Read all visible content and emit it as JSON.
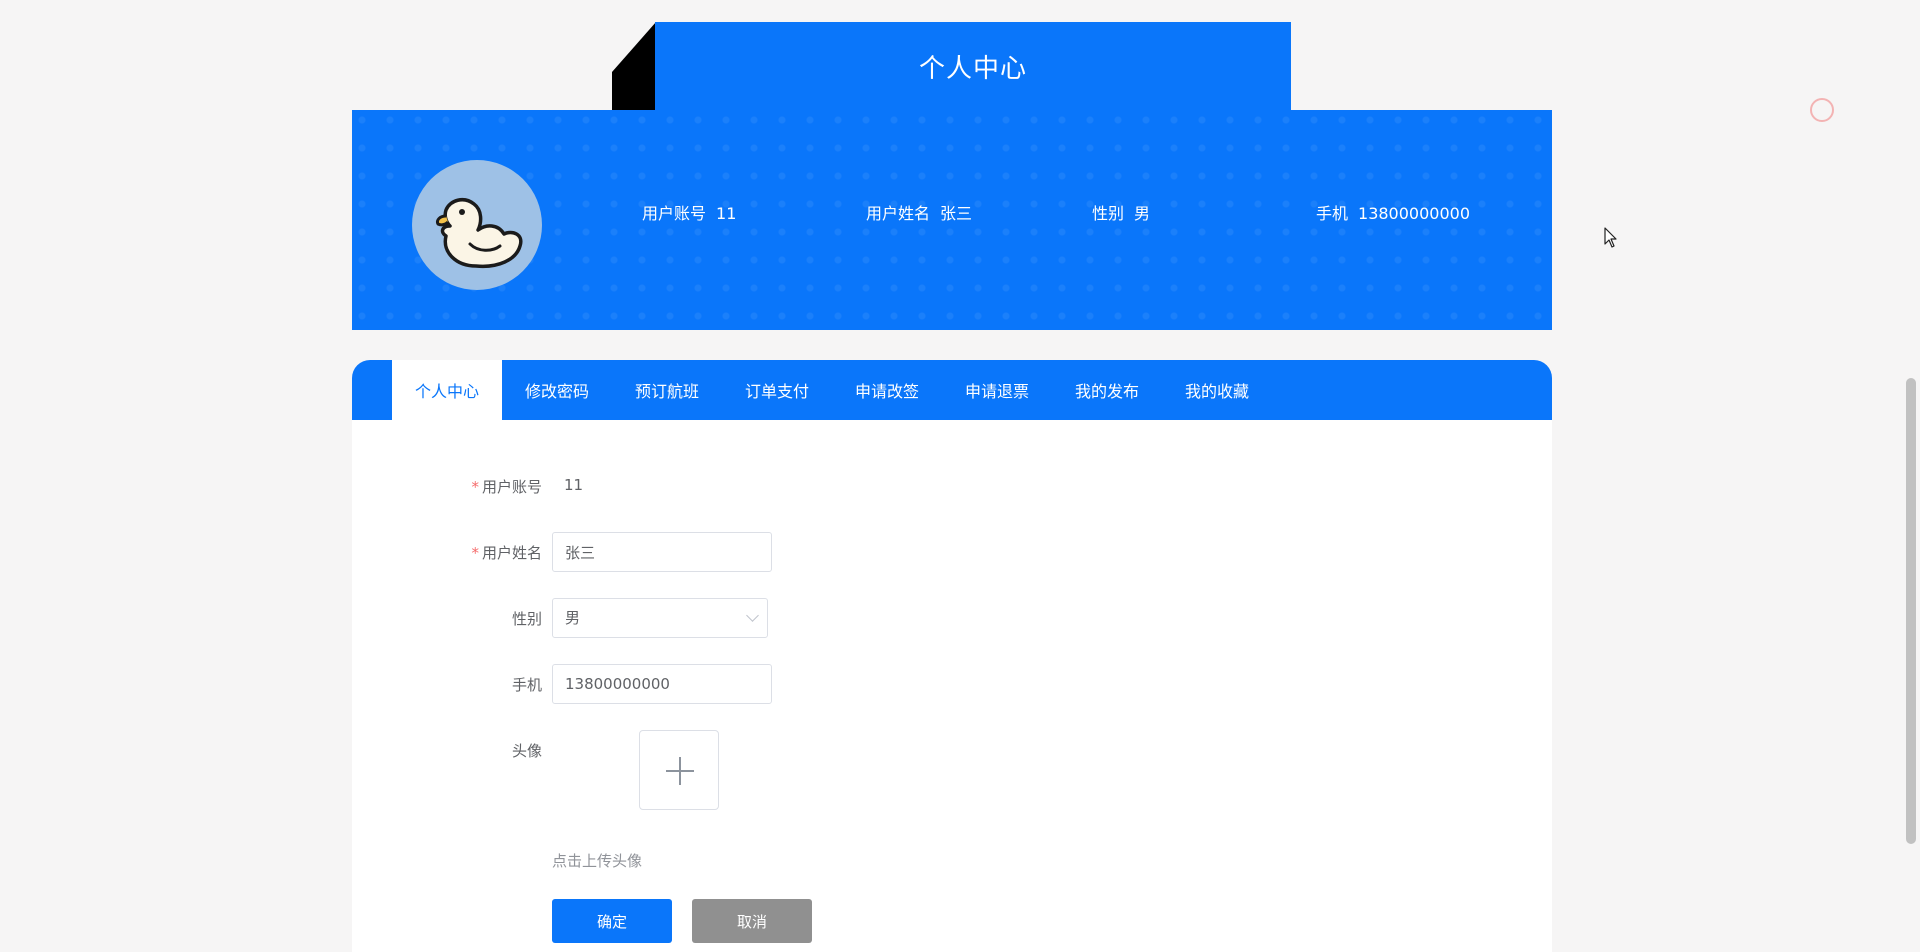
{
  "header": {
    "title": "个人中心"
  },
  "profile": {
    "account_label": "用户账号",
    "account_value": "11",
    "name_label": "用户姓名",
    "name_value": "张三",
    "gender_label": "性别",
    "gender_value": "男",
    "phone_label": "手机",
    "phone_value": "13800000000"
  },
  "tabs": [
    {
      "label": "个人中心",
      "active": true
    },
    {
      "label": "修改密码"
    },
    {
      "label": "预订航班"
    },
    {
      "label": "订单支付"
    },
    {
      "label": "申请改签"
    },
    {
      "label": "申请退票"
    },
    {
      "label": "我的发布"
    },
    {
      "label": "我的收藏"
    }
  ],
  "form": {
    "account_label": "用户账号",
    "account_value": "11",
    "name_label": "用户姓名",
    "name_value": "张三",
    "gender_label": "性别",
    "gender_value": "男",
    "phone_label": "手机",
    "phone_value": "13800000000",
    "avatar_label": "头像",
    "upload_hint": "点击上传头像",
    "confirm_label": "确定",
    "cancel_label": "取消"
  },
  "colors": {
    "accent": "#0a76fa",
    "cancel": "#909090",
    "required": "#f56c6c"
  }
}
